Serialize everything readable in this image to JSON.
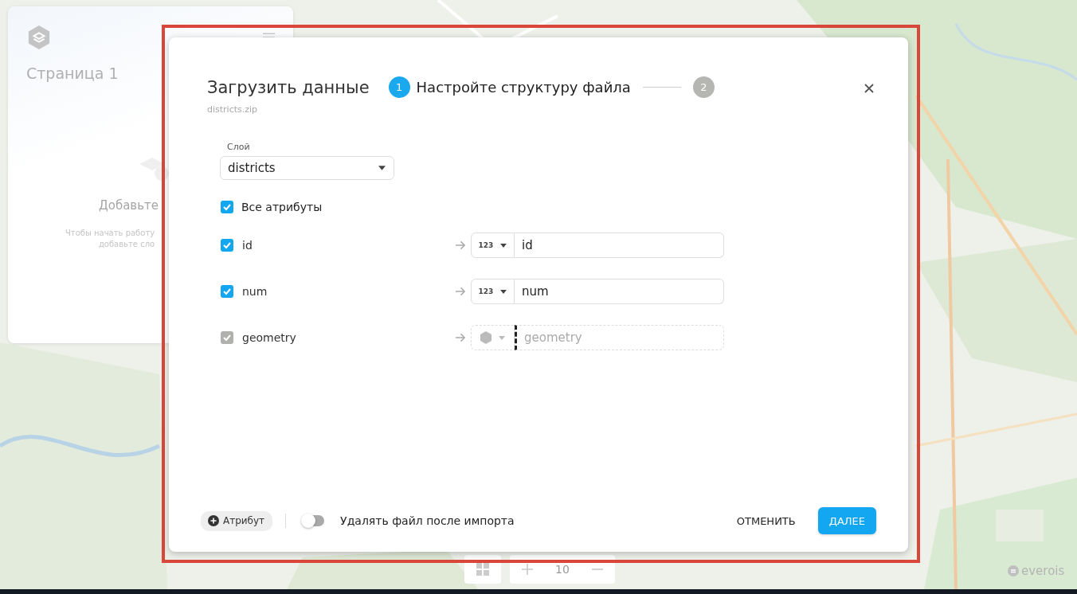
{
  "side_panel": {
    "page_title": "Страница 1",
    "empty_title": "Добавьте",
    "empty_hint_lines": [
      "Чтобы начать работу",
      "добавьте сло"
    ]
  },
  "dialog": {
    "title": "Загрузить данные",
    "file_name": "districts.zip",
    "steps": [
      {
        "number": "1",
        "label": "Настройте структуру файла",
        "selected": true
      },
      {
        "number": "2",
        "selected": false
      }
    ],
    "layer_field": {
      "label": "Слой",
      "value": "districts"
    },
    "all_attributes": {
      "label": "Все атрибуты",
      "checked": true
    },
    "attributes": [
      {
        "name": "id",
        "checked": true,
        "disabled": false,
        "kind": "number",
        "type_label": "123",
        "target": "id"
      },
      {
        "name": "num",
        "checked": true,
        "disabled": false,
        "kind": "number",
        "type_label": "123",
        "target": "num"
      },
      {
        "name": "geometry",
        "checked": true,
        "disabled": true,
        "kind": "geometry",
        "placeholder": "geometry"
      }
    ],
    "add_attribute_button": "Атрибут",
    "delete_toggle": {
      "label": "Удалять файл после импорта",
      "on": false
    },
    "cancel_button": "ОТМЕНИТЬ",
    "next_button": "ДАЛЕЕ"
  },
  "map_controls": {
    "zoom_level": "10"
  },
  "logo": "everois"
}
